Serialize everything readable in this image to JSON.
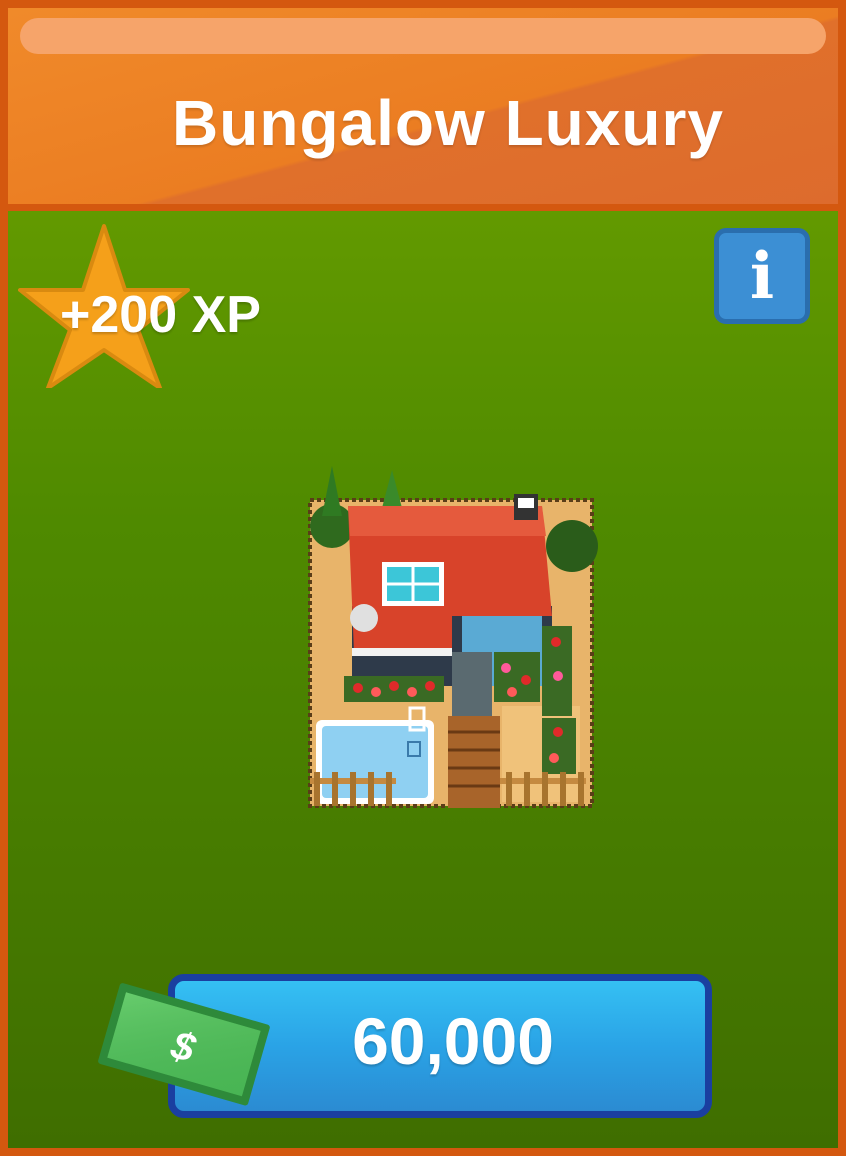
{
  "card": {
    "title": "Bungalow Luxury",
    "xp_label": "+200 XP",
    "info_label": "i",
    "price": "60,000",
    "currency_symbol": "$"
  },
  "icons": {
    "xp": "star-icon",
    "info": "info-icon",
    "currency": "cash-icon",
    "item": "bungalow-house-image"
  },
  "colors": {
    "border": "#d4580f",
    "header": "#eb7d22",
    "background_top": "#6fa400",
    "background_bottom": "#3f6e00",
    "star": "#f5a01a",
    "info_button": "#3c8fd4",
    "price_button": "#2aa3e6",
    "cash": "#3fae4a"
  }
}
